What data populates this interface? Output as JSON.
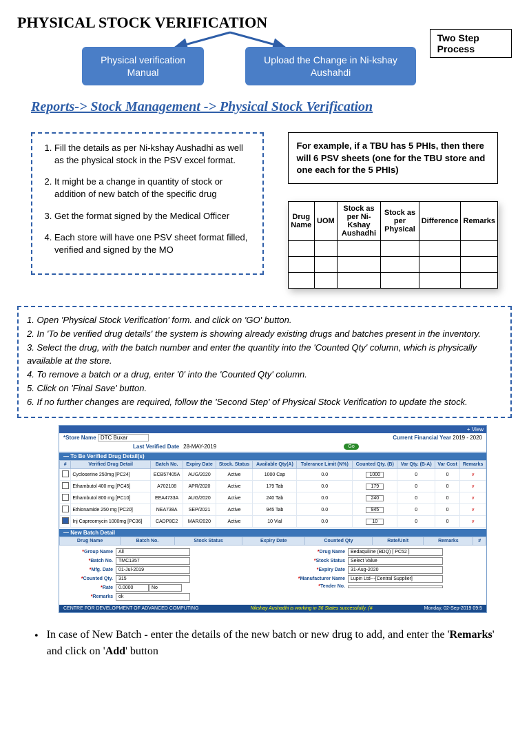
{
  "title": "PHYSICAL STOCK VERIFICATION",
  "boxes": {
    "left": "Physical verification Manual",
    "right": "Upload the Change in Ni-kshay Aushahdi",
    "tag": "Two Step Process"
  },
  "breadcrumb": "Reports-> Stock Management -> Physical Stock Verification",
  "ol": [
    "Fill the details as per Ni-kshay Aushadhi as well as the physical stock in the PSV excel format.",
    "It might be a change in quantity of stock or addition of new batch of the specific drug",
    "Get the format signed by the Medical Officer",
    "Each store will have one PSV sheet format filled, verified and signed by the MO"
  ],
  "example": "For example, if a TBU has 5 PHIs, then there will 6 PSV sheets (one for the TBU store and one each for the 5 PHIs)",
  "sheet_headers": [
    "Drug Name",
    "UOM",
    "Stock as per Ni-Kshay Aushadhi",
    "Stock as per Physical",
    "Difference",
    "Remarks"
  ],
  "steps": [
    "1. Open 'Physical Stock Verification' form. and click on 'GO' button.",
    "2.  In 'To be verified drug details' the system is showing already existing drugs and batches present in the inventory.",
    "3. Select the drug, with the batch number and enter the quantity into the 'Counted Qty' column, which is physically available at the store.",
    "4. To remove a batch or a drug, enter '0' into the 'Counted Qty' column.",
    "5. Click on 'Final Save' button.",
    "6. If no further changes are required, follow the 'Second Step' of Physical Stock Verification to update the stock."
  ],
  "ss": {
    "view": "+ View",
    "store_label": "*Store Name",
    "store_val": "DTC Buxar",
    "fy_label": "Current Financial Year",
    "fy_val": "2019 - 2020",
    "lastver_label": "Last Verified Date",
    "lastver_val": "28-MAY-2019",
    "go": "Go",
    "sec1": "— To Be Verified Drug Detail(s)",
    "cols": [
      "#",
      "Verified Drug Detail",
      "Batch No.",
      "Expiry Date",
      "Stock. Status",
      "Available Qty(A)",
      "Tolerance Limit (N%)",
      "Counted Qty. (B)",
      "Var Qty. (B-A)",
      "Var Cost",
      "Remarks"
    ],
    "rows": [
      {
        "drug": "Cycloserine 250mg [PC24]",
        "batch": "ECB57405A",
        "exp": "AUG/2020",
        "stat": "Active",
        "avail": "1000 Cap",
        "tol": "0.0",
        "cnt": "1000",
        "var": "0",
        "cost": "0",
        "rem": "v"
      },
      {
        "drug": "Ethambutol 400 mg [PC45]",
        "batch": "A702108",
        "exp": "APR/2020",
        "stat": "Active",
        "avail": "179 Tab",
        "tol": "0.0",
        "cnt": "179",
        "var": "0",
        "cost": "0",
        "rem": "v"
      },
      {
        "drug": "Ethambutol 800 mg [PC10]",
        "batch": "EEA4733A",
        "exp": "AUG/2020",
        "stat": "Active",
        "avail": "240 Tab",
        "tol": "0.0",
        "cnt": "240",
        "var": "0",
        "cost": "0",
        "rem": "v"
      },
      {
        "drug": "Ethionamide 250 mg [PC20]",
        "batch": "NEA738A",
        "exp": "SEP/2021",
        "stat": "Active",
        "avail": "945 Tab",
        "tol": "0.0",
        "cnt": "945",
        "var": "0",
        "cost": "0",
        "rem": "v"
      },
      {
        "drug": "Inj Capreomycin 1000mg [PC36]",
        "batch": "CADP8C2",
        "exp": "MAR/2020",
        "stat": "Active",
        "avail": "10 Vial",
        "tol": "0.0",
        "cnt": "10",
        "var": "0",
        "cost": "0",
        "rem": "v"
      }
    ],
    "sec2": "— New Batch Detail",
    "cols2": [
      "Drug Name",
      "Batch No.",
      "Stock Status",
      "Expiry Date",
      "Counted Qty",
      "Rate/Unit",
      "Remarks",
      "#"
    ],
    "form_left": {
      "group": "Group Name",
      "group_v": "All",
      "batch": "Batch No.",
      "batch_v": "TMC1357",
      "mfg": "Mfg. Date",
      "mfg_v": "01-Jul-2019",
      "cnt": "Counted Qty.",
      "cnt_v": "315",
      "rate": "Rate",
      "rate_v": "0.0000",
      "rate_u": "No",
      "rem": "Remarks",
      "rem_v": "ok"
    },
    "form_right": {
      "drug": "Drug Name",
      "drug_v": "Bedaquiline (BDQ) [ PC52 ]",
      "stock": "Stock Status",
      "stock_v": "Select Value",
      "exp": "Expiry Date",
      "exp_v": "31-Aug-2020",
      "mfr": "Manufacturer Name",
      "mfr_v": "Lupin Ltd---[Central Supplier]",
      "tender": "Tender No.",
      "tender_v": ""
    },
    "foot_l": "CENTRE FOR DEVELOPMENT OF ADVANCED COMPUTING",
    "foot_c": "Nikshay Aushadhi is working in 36 States successfully. (#",
    "foot_r": "Monday, 02-Sep-2019 09:5"
  },
  "bullet_pre": "In case of New Batch - enter the details of the new batch or new drug to add, and enter the '",
  "bullet_b1": "Remarks",
  "bullet_mid": "' and click on '",
  "bullet_b2": "Add",
  "bullet_post": "' button"
}
